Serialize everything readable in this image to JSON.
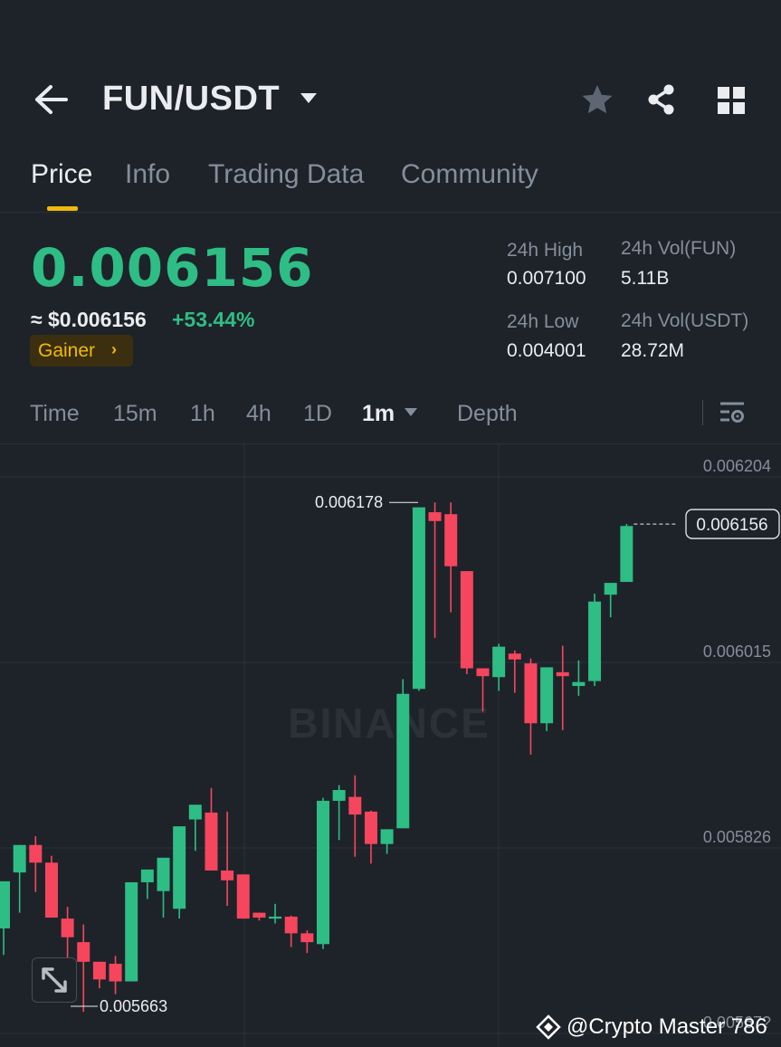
{
  "header": {
    "pair": "FUN/USDT",
    "icons": [
      "back-arrow-icon",
      "caret-down-icon",
      "star-icon",
      "share-icon",
      "grid-icon"
    ]
  },
  "tabs": [
    {
      "label": "Price",
      "active": true
    },
    {
      "label": "Info"
    },
    {
      "label": "Trading Data"
    },
    {
      "label": "Community"
    }
  ],
  "ticker": {
    "last_price": "0.006156",
    "usd_price": "≈ $0.006156",
    "change": "+53.44%",
    "badge": "Gainer",
    "badge_chevron": "›",
    "stats": {
      "high_label": "24h High",
      "high_value": "0.007100",
      "vol_base_label": "24h Vol(FUN)",
      "vol_base_value": "5.11B",
      "low_label": "24h Low",
      "low_value": "0.004001",
      "vol_quote_label": "24h Vol(USDT)",
      "vol_quote_value": "28.72M"
    }
  },
  "intervals": [
    {
      "label": "Time"
    },
    {
      "label": "15m"
    },
    {
      "label": "1h"
    },
    {
      "label": "4h"
    },
    {
      "label": "1D"
    },
    {
      "label": "1m",
      "active": true
    },
    {
      "label": "Depth"
    }
  ],
  "colors": {
    "up": "#2ebd85",
    "down": "#f6465d",
    "accent": "#f0b90b",
    "bg": "#1e2329"
  },
  "watermark": "BINANCE",
  "credit": "@Crypto Master 786",
  "chart_data": {
    "type": "candlestick",
    "y_ticks": [
      "0.006204",
      "0.006015",
      "0.005826",
      "0.00567?"
    ],
    "y_tick_values": [
      0.006204,
      0.006015,
      0.005826,
      0.005637
    ],
    "current_price_label": "0.006156",
    "current_price": 0.006156,
    "high_marker": {
      "label": "0.006178",
      "value": 0.006178
    },
    "low_marker": {
      "label": "0.005663",
      "value": 0.005663
    },
    "candles": [
      {
        "o": 5744,
        "h": 5790,
        "l": 5717,
        "c": 5792
      },
      {
        "o": 5801,
        "h": 5827,
        "l": 5760,
        "c": 5829
      },
      {
        "o": 5829,
        "h": 5838,
        "l": 5781,
        "c": 5811
      },
      {
        "o": 5811,
        "h": 5818,
        "l": 5757,
        "c": 5755
      },
      {
        "o": 5754,
        "h": 5766,
        "l": 5713,
        "c": 5735
      },
      {
        "o": 5730,
        "h": 5748,
        "l": 5659,
        "c": 5710
      },
      {
        "o": 5710,
        "h": 5689,
        "l": 5683,
        "c": 5692
      },
      {
        "o": 5708,
        "h": 5716,
        "l": 5677,
        "c": 5690
      },
      {
        "o": 5690,
        "h": 5788,
        "l": 5691,
        "c": 5791
      },
      {
        "o": 5791,
        "h": 5751,
        "l": 5774,
        "c": 5804
      },
      {
        "o": 5782,
        "h": 5808,
        "l": 5755,
        "c": 5816
      },
      {
        "o": 5764,
        "h": 5848,
        "l": 5754,
        "c": 5848
      },
      {
        "o": 5855,
        "h": 5867,
        "l": 5823,
        "c": 5870
      },
      {
        "o": 5862,
        "h": 5887,
        "l": 5812,
        "c": 5803
      },
      {
        "o": 5803,
        "h": 5863,
        "l": 5767,
        "c": 5793
      },
      {
        "o": 5799,
        "h": 5781,
        "l": 5769,
        "c": 5754
      },
      {
        "o": 5760,
        "h": 5758,
        "l": 5752,
        "c": 5755
      },
      {
        "o": 5754,
        "h": 5769,
        "l": 5749,
        "c": 5756
      },
      {
        "o": 5756,
        "h": 5757,
        "l": 5725,
        "c": 5739
      },
      {
        "o": 5739,
        "h": 5742,
        "l": 5719,
        "c": 5730
      },
      {
        "o": 5728,
        "h": 5877,
        "l": 5723,
        "c": 5874
      },
      {
        "o": 5874,
        "h": 5890,
        "l": 5834,
        "c": 5885
      },
      {
        "o": 5878,
        "h": 5900,
        "l": 5817,
        "c": 5860
      },
      {
        "o": 5863,
        "h": 5864,
        "l": 5810,
        "c": 5830
      },
      {
        "o": 5830,
        "h": 5843,
        "l": 5820,
        "c": 5845
      },
      {
        "o": 5846,
        "h": 5998,
        "l": 5846,
        "c": 5983
      },
      {
        "o": 5988,
        "h": 6154,
        "l": 5986,
        "c": 6173
      },
      {
        "o": 6168,
        "h": 6178,
        "l": 6040,
        "c": 6159
      },
      {
        "o": 6166,
        "h": 6178,
        "l": 6066,
        "c": 6113
      },
      {
        "o": 6108,
        "h": 6108,
        "l": 6003,
        "c": 6009
      },
      {
        "o": 6009,
        "h": 6006,
        "l": 5965,
        "c": 6001
      },
      {
        "o": 6000,
        "h": 6034,
        "l": 5986,
        "c": 6031
      },
      {
        "o": 6024,
        "h": 6027,
        "l": 5984,
        "c": 6018
      },
      {
        "o": 6014,
        "h": 6019,
        "l": 5921,
        "c": 5953
      },
      {
        "o": 5953,
        "h": 6006,
        "l": 5945,
        "c": 6010
      },
      {
        "o": 6005,
        "h": 6032,
        "l": 5946,
        "c": 6001
      },
      {
        "o": 5991,
        "h": 6017,
        "l": 5981,
        "c": 5995
      },
      {
        "o": 5996,
        "h": 6085,
        "l": 5991,
        "c": 6077
      },
      {
        "o": 6084,
        "h": 6087,
        "l": 6061,
        "c": 6096
      },
      {
        "o": 6097,
        "h": 6156,
        "l": 6103,
        "c": 6154
      }
    ]
  }
}
